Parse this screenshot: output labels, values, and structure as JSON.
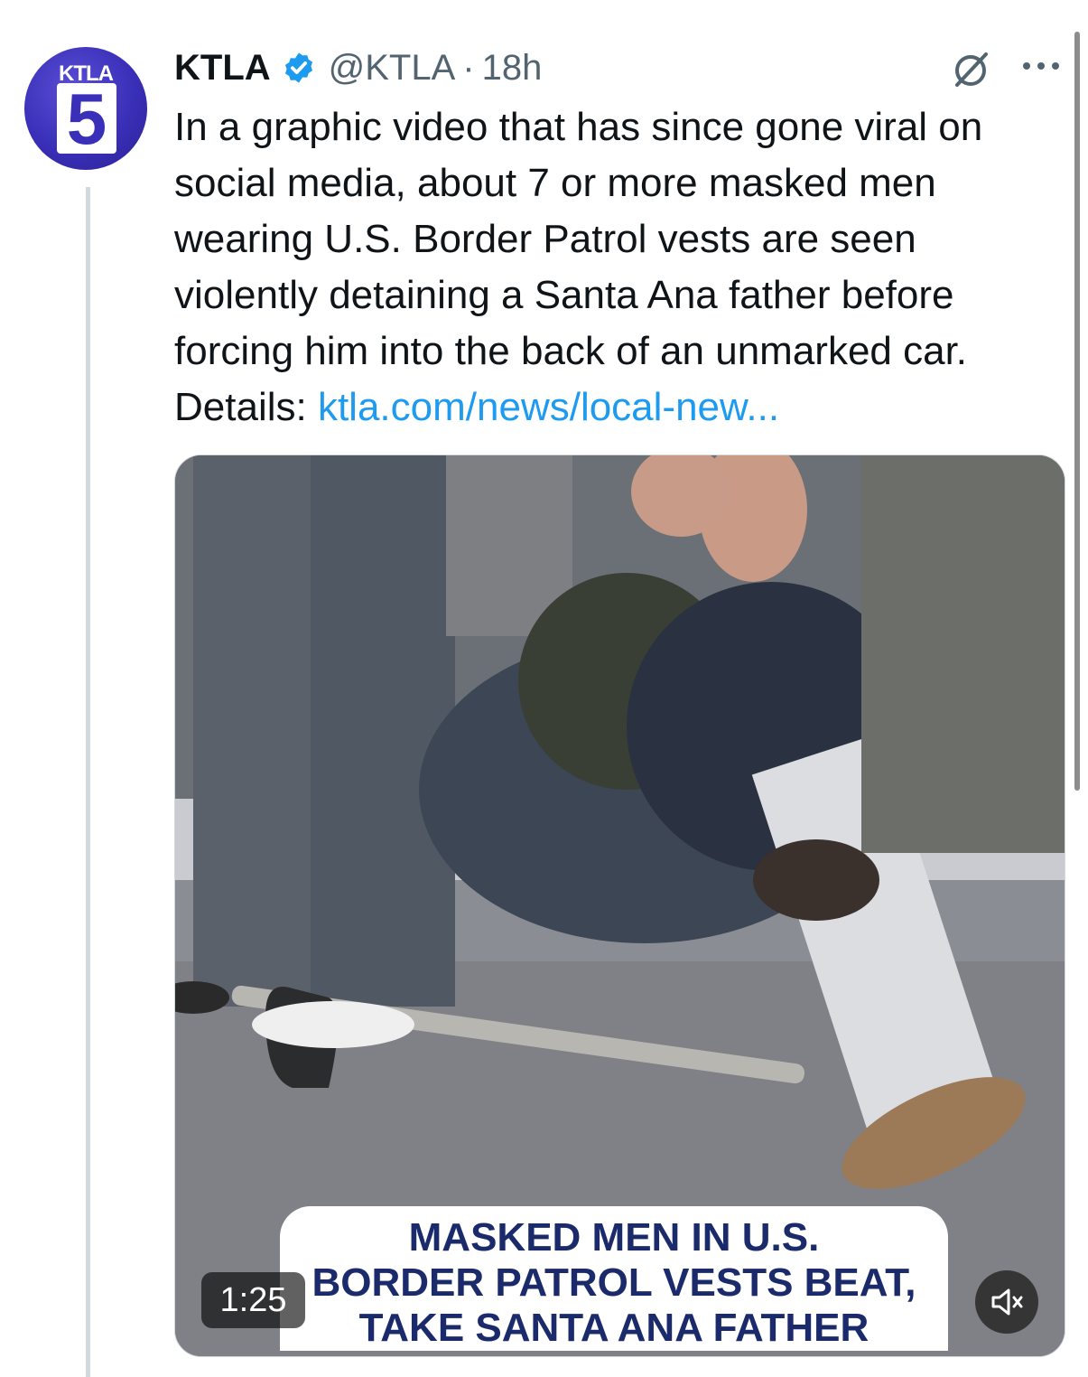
{
  "author": {
    "logo_station": "KTLA",
    "logo_channel": "5",
    "name": "KTLA",
    "handle": "@KTLA",
    "separator": "·",
    "time": "18h"
  },
  "tweet": {
    "text": "In a graphic video that has since gone viral on social media, about 7 or more masked men wearing U.S. Border Patrol vests are seen violently detaining a Santa Ana father before forcing him into the back of an unmarked car. Details: ",
    "link": "ktla.com/news/local-new..."
  },
  "video": {
    "caption_line1": "MASKED MEN IN U.S.",
    "caption_line2": "BORDER PATROL VESTS BEAT,",
    "caption_line3": "TAKE SANTA ANA FATHER",
    "duration": "1:25"
  },
  "colors": {
    "link": "#1d9bf0",
    "verified": "#1d9bf0",
    "caption_text": "#1b2a6b",
    "avatar_bg": "#3a2fb8"
  },
  "icons": {
    "verified": "verified-badge-icon",
    "grok": "grok-icon",
    "more": "more-icon",
    "mute": "speaker-muted-icon"
  }
}
